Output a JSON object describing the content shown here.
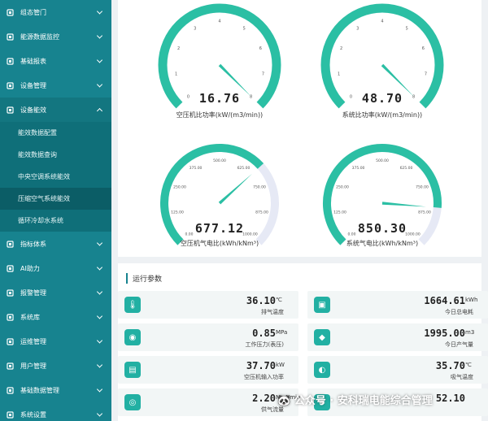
{
  "sidebar": {
    "items": [
      {
        "label": "组态管门",
        "expanded": false
      },
      {
        "label": "能源数据监控",
        "expanded": false
      },
      {
        "label": "基础报表",
        "expanded": false
      },
      {
        "label": "设备管理",
        "expanded": false
      },
      {
        "label": "设备能效",
        "expanded": true,
        "children": [
          {
            "label": "能效数据配置",
            "active": false
          },
          {
            "label": "能效数据查询",
            "active": false
          },
          {
            "label": "中央空调系统能效",
            "active": false
          },
          {
            "label": "压缩空气系统能效",
            "active": true
          },
          {
            "label": "循环冷却水系统",
            "active": false
          }
        ]
      },
      {
        "label": "指标体系",
        "expanded": false
      },
      {
        "label": "AI助力",
        "expanded": false
      },
      {
        "label": "报警管理",
        "expanded": false
      },
      {
        "label": "系统库",
        "expanded": false
      },
      {
        "label": "运维管理",
        "expanded": false
      },
      {
        "label": "用户管理",
        "expanded": false
      },
      {
        "label": "基础数据管理",
        "expanded": false
      },
      {
        "label": "系统设置",
        "expanded": false
      }
    ]
  },
  "gauges": [
    {
      "value": "16.76",
      "label": "空压机比功率(kW/(m3/min))",
      "min": 0,
      "max": 8,
      "ticks": [
        "0",
        "1",
        "2",
        "3",
        "4",
        "5",
        "6",
        "7",
        "8"
      ],
      "needle": 16.76,
      "clamp": 8
    },
    {
      "value": "48.70",
      "label": "系统比功率(kW/(m3/min))",
      "min": 0,
      "max": 8,
      "ticks": [
        "0",
        "1",
        "2",
        "3",
        "4",
        "5",
        "6",
        "7",
        "8"
      ],
      "needle": 48.7,
      "clamp": 8
    },
    {
      "value": "677.12",
      "label": "空压机气电比(kWh/kNm³)",
      "min": 0,
      "max": 1000,
      "ticks": [
        "0.00",
        "125.00",
        "250.00",
        "375.00",
        "500.00",
        "625.00",
        "750.00",
        "875.00",
        "1000.00"
      ],
      "needle": 677.12,
      "clamp": 1000
    },
    {
      "value": "850.30",
      "label": "系统气电比(kWh/kNm³)",
      "min": 0,
      "max": 1000,
      "ticks": [
        "0.00",
        "125.00",
        "250.00",
        "375.00",
        "500.00",
        "625.00",
        "750.00",
        "875.00",
        "1000.00"
      ],
      "needle": 850.3,
      "clamp": 1000
    }
  ],
  "params": {
    "title": "运行参数",
    "cards": [
      {
        "value": "36.10",
        "unit": "℃",
        "name": "排气温度",
        "icon": "thermometer-icon",
        "glyph": "🌡"
      },
      {
        "value": "1664.61",
        "unit": "kWh",
        "name": "今日总电耗",
        "icon": "meter-icon",
        "glyph": "▣"
      },
      {
        "value": "0.85",
        "unit": "MPa",
        "name": "工作压力(表压)",
        "icon": "pressure-icon",
        "glyph": "◉"
      },
      {
        "value": "1995.00",
        "unit": "m3",
        "name": "今日产气量",
        "icon": "gas-icon",
        "glyph": "◆"
      },
      {
        "value": "37.70",
        "unit": "kW",
        "name": "空压机输入功率",
        "icon": "power-icon",
        "glyph": "▤"
      },
      {
        "value": "35.70",
        "unit": "℃",
        "name": "吸气温度",
        "icon": "intake-icon",
        "glyph": "◐"
      },
      {
        "value": "2.20",
        "unit": "Nm³/min",
        "name": "供气流量",
        "icon": "flow-icon",
        "glyph": "◎"
      },
      {
        "value": "52.10",
        "unit": "",
        "name": "",
        "icon": "misc-icon",
        "glyph": "✱"
      }
    ]
  },
  "watermark": "🐼 公众号 · 安科瑞电能综合管理"
}
